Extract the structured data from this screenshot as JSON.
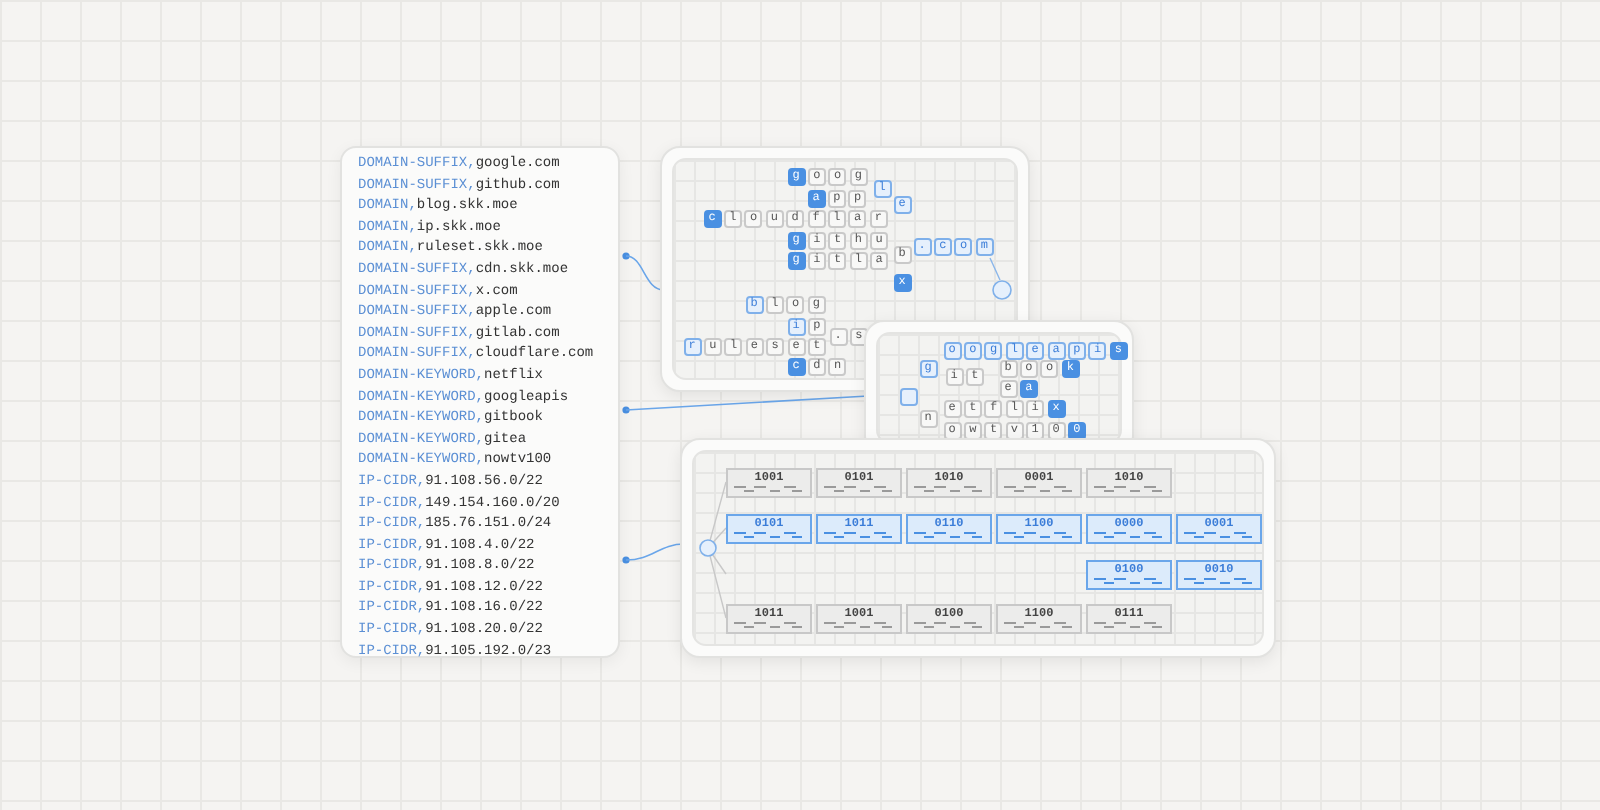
{
  "rules": [
    {
      "prefix": "DOMAIN-SUFFIX,",
      "value": "google.com"
    },
    {
      "prefix": "DOMAIN-SUFFIX,",
      "value": "github.com"
    },
    {
      "prefix": "DOMAIN,",
      "value": "blog.skk.moe"
    },
    {
      "prefix": "DOMAIN,",
      "value": "ip.skk.moe"
    },
    {
      "prefix": "DOMAIN,",
      "value": "ruleset.skk.moe"
    },
    {
      "prefix": "DOMAIN-SUFFIX,",
      "value": "cdn.skk.moe"
    },
    {
      "prefix": "DOMAIN-SUFFIX,",
      "value": "x.com"
    },
    {
      "prefix": "DOMAIN-SUFFIX,",
      "value": "apple.com"
    },
    {
      "prefix": "DOMAIN-SUFFIX,",
      "value": "gitlab.com"
    },
    {
      "prefix": "DOMAIN-SUFFIX,",
      "value": "cloudflare.com"
    },
    {
      "prefix": "DOMAIN-KEYWORD,",
      "value": "netflix"
    },
    {
      "prefix": "DOMAIN-KEYWORD,",
      "value": "googleapis"
    },
    {
      "prefix": "DOMAIN-KEYWORD,",
      "value": "gitbook"
    },
    {
      "prefix": "DOMAIN-KEYWORD,",
      "value": "gitea"
    },
    {
      "prefix": "DOMAIN-KEYWORD,",
      "value": "nowtv100"
    },
    {
      "prefix": "IP-CIDR,",
      "value": "91.108.56.0/22"
    },
    {
      "prefix": "IP-CIDR,",
      "value": "149.154.160.0/20"
    },
    {
      "prefix": "IP-CIDR,",
      "value": "185.76.151.0/24"
    },
    {
      "prefix": "IP-CIDR,",
      "value": "91.108.4.0/22"
    },
    {
      "prefix": "IP-CIDR,",
      "value": "91.108.8.0/22"
    },
    {
      "prefix": "IP-CIDR,",
      "value": "91.108.12.0/22"
    },
    {
      "prefix": "IP-CIDR,",
      "value": "91.108.16.0/22"
    },
    {
      "prefix": "IP-CIDR,",
      "value": "91.108.20.0/22"
    },
    {
      "prefix": "IP-CIDR,",
      "value": "91.105.192.0/23"
    }
  ],
  "suffix_trie": {
    "rows": [
      {
        "tiles": [
          {
            "char": "g",
            "kind": "end"
          },
          {
            "char": "o",
            "kind": "plain"
          },
          {
            "char": "o",
            "kind": "plain"
          },
          {
            "char": "g",
            "kind": "plain"
          }
        ]
      },
      {
        "tiles": [
          {
            "char": "l",
            "kind": "path"
          }
        ]
      },
      {
        "tiles": [
          {
            "char": "e",
            "kind": "path"
          }
        ]
      },
      {
        "tiles": [
          {
            "char": "a",
            "kind": "end"
          },
          {
            "char": "p",
            "kind": "plain"
          },
          {
            "char": "p",
            "kind": "plain"
          }
        ]
      },
      {
        "tiles": [
          {
            "char": "c",
            "kind": "end"
          },
          {
            "char": "l",
            "kind": "plain"
          },
          {
            "char": "o",
            "kind": "plain"
          },
          {
            "char": "u",
            "kind": "plain"
          },
          {
            "char": "d",
            "kind": "plain"
          },
          {
            "char": "f",
            "kind": "plain"
          },
          {
            "char": "l",
            "kind": "plain"
          },
          {
            "char": "a",
            "kind": "plain"
          },
          {
            "char": "r",
            "kind": "plain"
          }
        ]
      },
      {
        "tiles": [
          {
            "char": "g",
            "kind": "end"
          },
          {
            "char": "i",
            "kind": "plain"
          },
          {
            "char": "t",
            "kind": "plain"
          },
          {
            "char": "h",
            "kind": "plain"
          },
          {
            "char": "u",
            "kind": "plain"
          }
        ]
      },
      {
        "tiles": [
          {
            "char": "b",
            "kind": "plain"
          }
        ]
      },
      {
        "tiles": [
          {
            "char": "g",
            "kind": "end"
          },
          {
            "char": "i",
            "kind": "plain"
          },
          {
            "char": "t",
            "kind": "plain"
          },
          {
            "char": "l",
            "kind": "plain"
          },
          {
            "char": "a",
            "kind": "plain"
          }
        ]
      },
      {
        "tiles": [
          {
            "char": ".",
            "kind": "path"
          },
          {
            "char": "c",
            "kind": "path"
          },
          {
            "char": "o",
            "kind": "path"
          },
          {
            "char": "m",
            "kind": "path"
          }
        ]
      },
      {
        "tiles": [
          {
            "char": "x",
            "kind": "end"
          }
        ]
      },
      {
        "tiles": [
          {
            "char": "b",
            "kind": "path"
          },
          {
            "char": "l",
            "kind": "plain"
          },
          {
            "char": "o",
            "kind": "plain"
          },
          {
            "char": "g",
            "kind": "plain"
          }
        ]
      },
      {
        "tiles": [
          {
            "char": "i",
            "kind": "path"
          },
          {
            "char": "p",
            "kind": "plain"
          }
        ]
      },
      {
        "tiles": [
          {
            "char": "r",
            "kind": "path"
          },
          {
            "char": "u",
            "kind": "plain"
          },
          {
            "char": "l",
            "kind": "plain"
          },
          {
            "char": "e",
            "kind": "plain"
          },
          {
            "char": "s",
            "kind": "plain"
          },
          {
            "char": "e",
            "kind": "plain"
          },
          {
            "char": "t",
            "kind": "plain"
          }
        ]
      },
      {
        "tiles": [
          {
            "char": ".",
            "kind": "plain"
          },
          {
            "char": "s",
            "kind": "plain"
          }
        ]
      },
      {
        "tiles": [
          {
            "char": "c",
            "kind": "end"
          },
          {
            "char": "d",
            "kind": "plain"
          },
          {
            "char": "n",
            "kind": "plain"
          }
        ]
      }
    ]
  },
  "keyword_trie": {
    "rows": [
      {
        "tiles": [
          {
            "char": "g",
            "kind": "path"
          }
        ]
      },
      {
        "tiles": [
          {
            "char": "o",
            "kind": "path"
          },
          {
            "char": "o",
            "kind": "path"
          },
          {
            "char": "g",
            "kind": "path"
          },
          {
            "char": "l",
            "kind": "path"
          },
          {
            "char": "e",
            "kind": "path"
          },
          {
            "char": "a",
            "kind": "path"
          },
          {
            "char": "p",
            "kind": "path"
          },
          {
            "char": "i",
            "kind": "path"
          },
          {
            "char": "s",
            "kind": "end"
          }
        ]
      },
      {
        "tiles": [
          {
            "char": "i",
            "kind": "plain"
          },
          {
            "char": "t",
            "kind": "plain"
          }
        ]
      },
      {
        "tiles": [
          {
            "char": "b",
            "kind": "plain"
          },
          {
            "char": "o",
            "kind": "plain"
          },
          {
            "char": "o",
            "kind": "plain"
          },
          {
            "char": "k",
            "kind": "end"
          }
        ]
      },
      {
        "tiles": [
          {
            "char": "e",
            "kind": "plain"
          },
          {
            "char": "a",
            "kind": "end"
          }
        ]
      },
      {
        "tiles": [
          {
            "char": "n",
            "kind": "plain"
          }
        ]
      },
      {
        "tiles": [
          {
            "char": "e",
            "kind": "plain"
          },
          {
            "char": "t",
            "kind": "plain"
          },
          {
            "char": "f",
            "kind": "plain"
          },
          {
            "char": "l",
            "kind": "plain"
          },
          {
            "char": "i",
            "kind": "plain"
          },
          {
            "char": "x",
            "kind": "end"
          }
        ]
      },
      {
        "tiles": [
          {
            "char": "o",
            "kind": "plain"
          },
          {
            "char": "w",
            "kind": "plain"
          },
          {
            "char": "t",
            "kind": "plain"
          },
          {
            "char": "v",
            "kind": "plain"
          },
          {
            "char": "1",
            "kind": "plain"
          },
          {
            "char": "0",
            "kind": "plain"
          },
          {
            "char": "0",
            "kind": "end"
          }
        ]
      }
    ]
  },
  "cidr_trie": {
    "rows": [
      {
        "cards": [
          {
            "bits": "1001",
            "active": false
          },
          {
            "bits": "0101",
            "active": false
          },
          {
            "bits": "1010",
            "active": false
          },
          {
            "bits": "0001",
            "active": false
          },
          {
            "bits": "1010",
            "active": false
          }
        ]
      },
      {
        "cards": [
          {
            "bits": "0101",
            "active": true
          },
          {
            "bits": "1011",
            "active": true
          },
          {
            "bits": "0110",
            "active": true
          },
          {
            "bits": "1100",
            "active": true
          },
          {
            "bits": "0000",
            "active": true
          },
          {
            "bits": "0001",
            "active": true
          }
        ]
      },
      {
        "cards": [
          {
            "bits": "0100",
            "active": true
          },
          {
            "bits": "0010",
            "active": true
          }
        ]
      },
      {
        "cards": [
          {
            "bits": "1011",
            "active": false
          },
          {
            "bits": "1001",
            "active": false
          },
          {
            "bits": "0100",
            "active": false
          },
          {
            "bits": "1100",
            "active": false
          },
          {
            "bits": "0111",
            "active": false
          }
        ]
      }
    ]
  }
}
